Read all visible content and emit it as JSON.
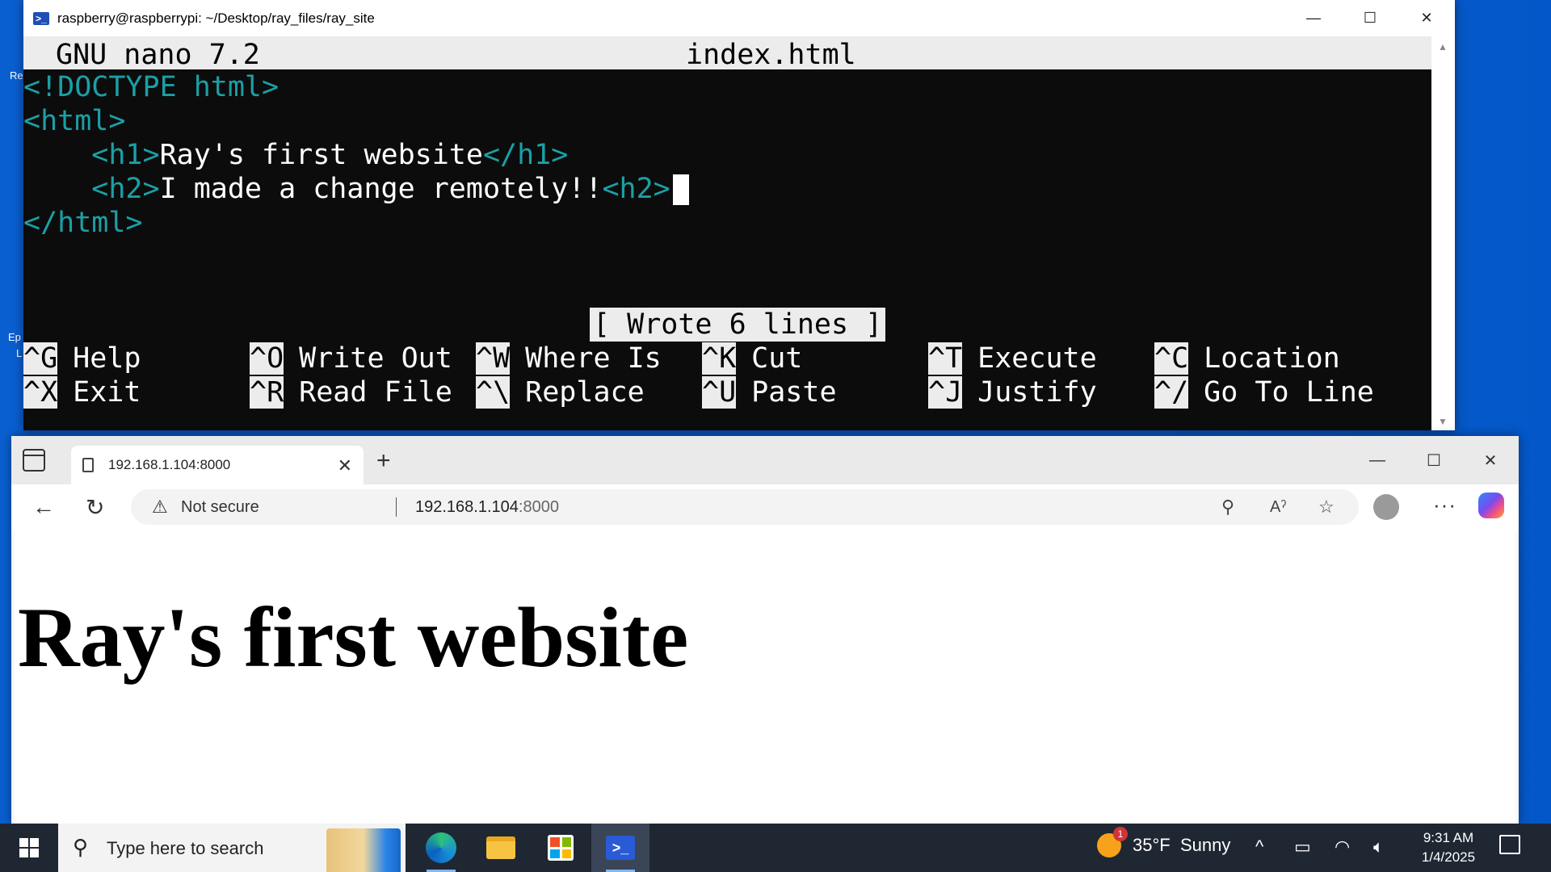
{
  "terminal": {
    "title": "raspberry@raspberrypi: ~/Desktop/ray_files/ray_site",
    "minimize": "—",
    "maximize": "☐",
    "close": "✕"
  },
  "nano": {
    "version": "GNU nano 7.2",
    "filename": "index.html",
    "lines": [
      {
        "tag_open": "<!DOCTYPE html>",
        "text": "",
        "tag_close": ""
      },
      {
        "tag_open": "<html>",
        "text": "",
        "tag_close": ""
      },
      {
        "tag_open": "    <h1>",
        "text": "Ray's first website",
        "tag_close": "</h1>"
      },
      {
        "tag_open": "    <h2>",
        "text": "I made a change remotely!!",
        "tag_close": "<h2>"
      },
      {
        "tag_open": "</html>",
        "text": "",
        "tag_close": ""
      }
    ],
    "status": "[ Wrote 6 lines ]",
    "shortcuts": [
      {
        "key": "^G",
        "label": "Help"
      },
      {
        "key": "^O",
        "label": "Write Out"
      },
      {
        "key": "^W",
        "label": "Where Is"
      },
      {
        "key": "^K",
        "label": "Cut"
      },
      {
        "key": "^T",
        "label": "Execute"
      },
      {
        "key": "^C",
        "label": "Location"
      },
      {
        "key": "^X",
        "label": "Exit"
      },
      {
        "key": "^R",
        "label": "Read File"
      },
      {
        "key": "^\\",
        "label": "Replace"
      },
      {
        "key": "^U",
        "label": "Paste"
      },
      {
        "key": "^J",
        "label": "Justify"
      },
      {
        "key": "^/",
        "label": "Go To Line"
      }
    ]
  },
  "browser": {
    "tab_title": "192.168.1.104:8000",
    "tab_close": "✕",
    "new_tab": "+",
    "security_label": "Not secure",
    "url_host": "192.168.1.104",
    "url_port": ":8000",
    "page_heading": "Ray's first website"
  },
  "taskbar": {
    "search_placeholder": "Type here to search",
    "weather_temp": "35°F",
    "weather_desc": "Sunny",
    "weather_badge": "1",
    "time": "9:31 AM",
    "date": "1/4/2025"
  },
  "desktop": {
    "fragments": [
      "Re",
      "Ep",
      "L"
    ]
  },
  "icons": {
    "powershell": "powershell-icon",
    "edge": "edge-icon",
    "explorer": "folder-icon",
    "store": "store-icon"
  }
}
